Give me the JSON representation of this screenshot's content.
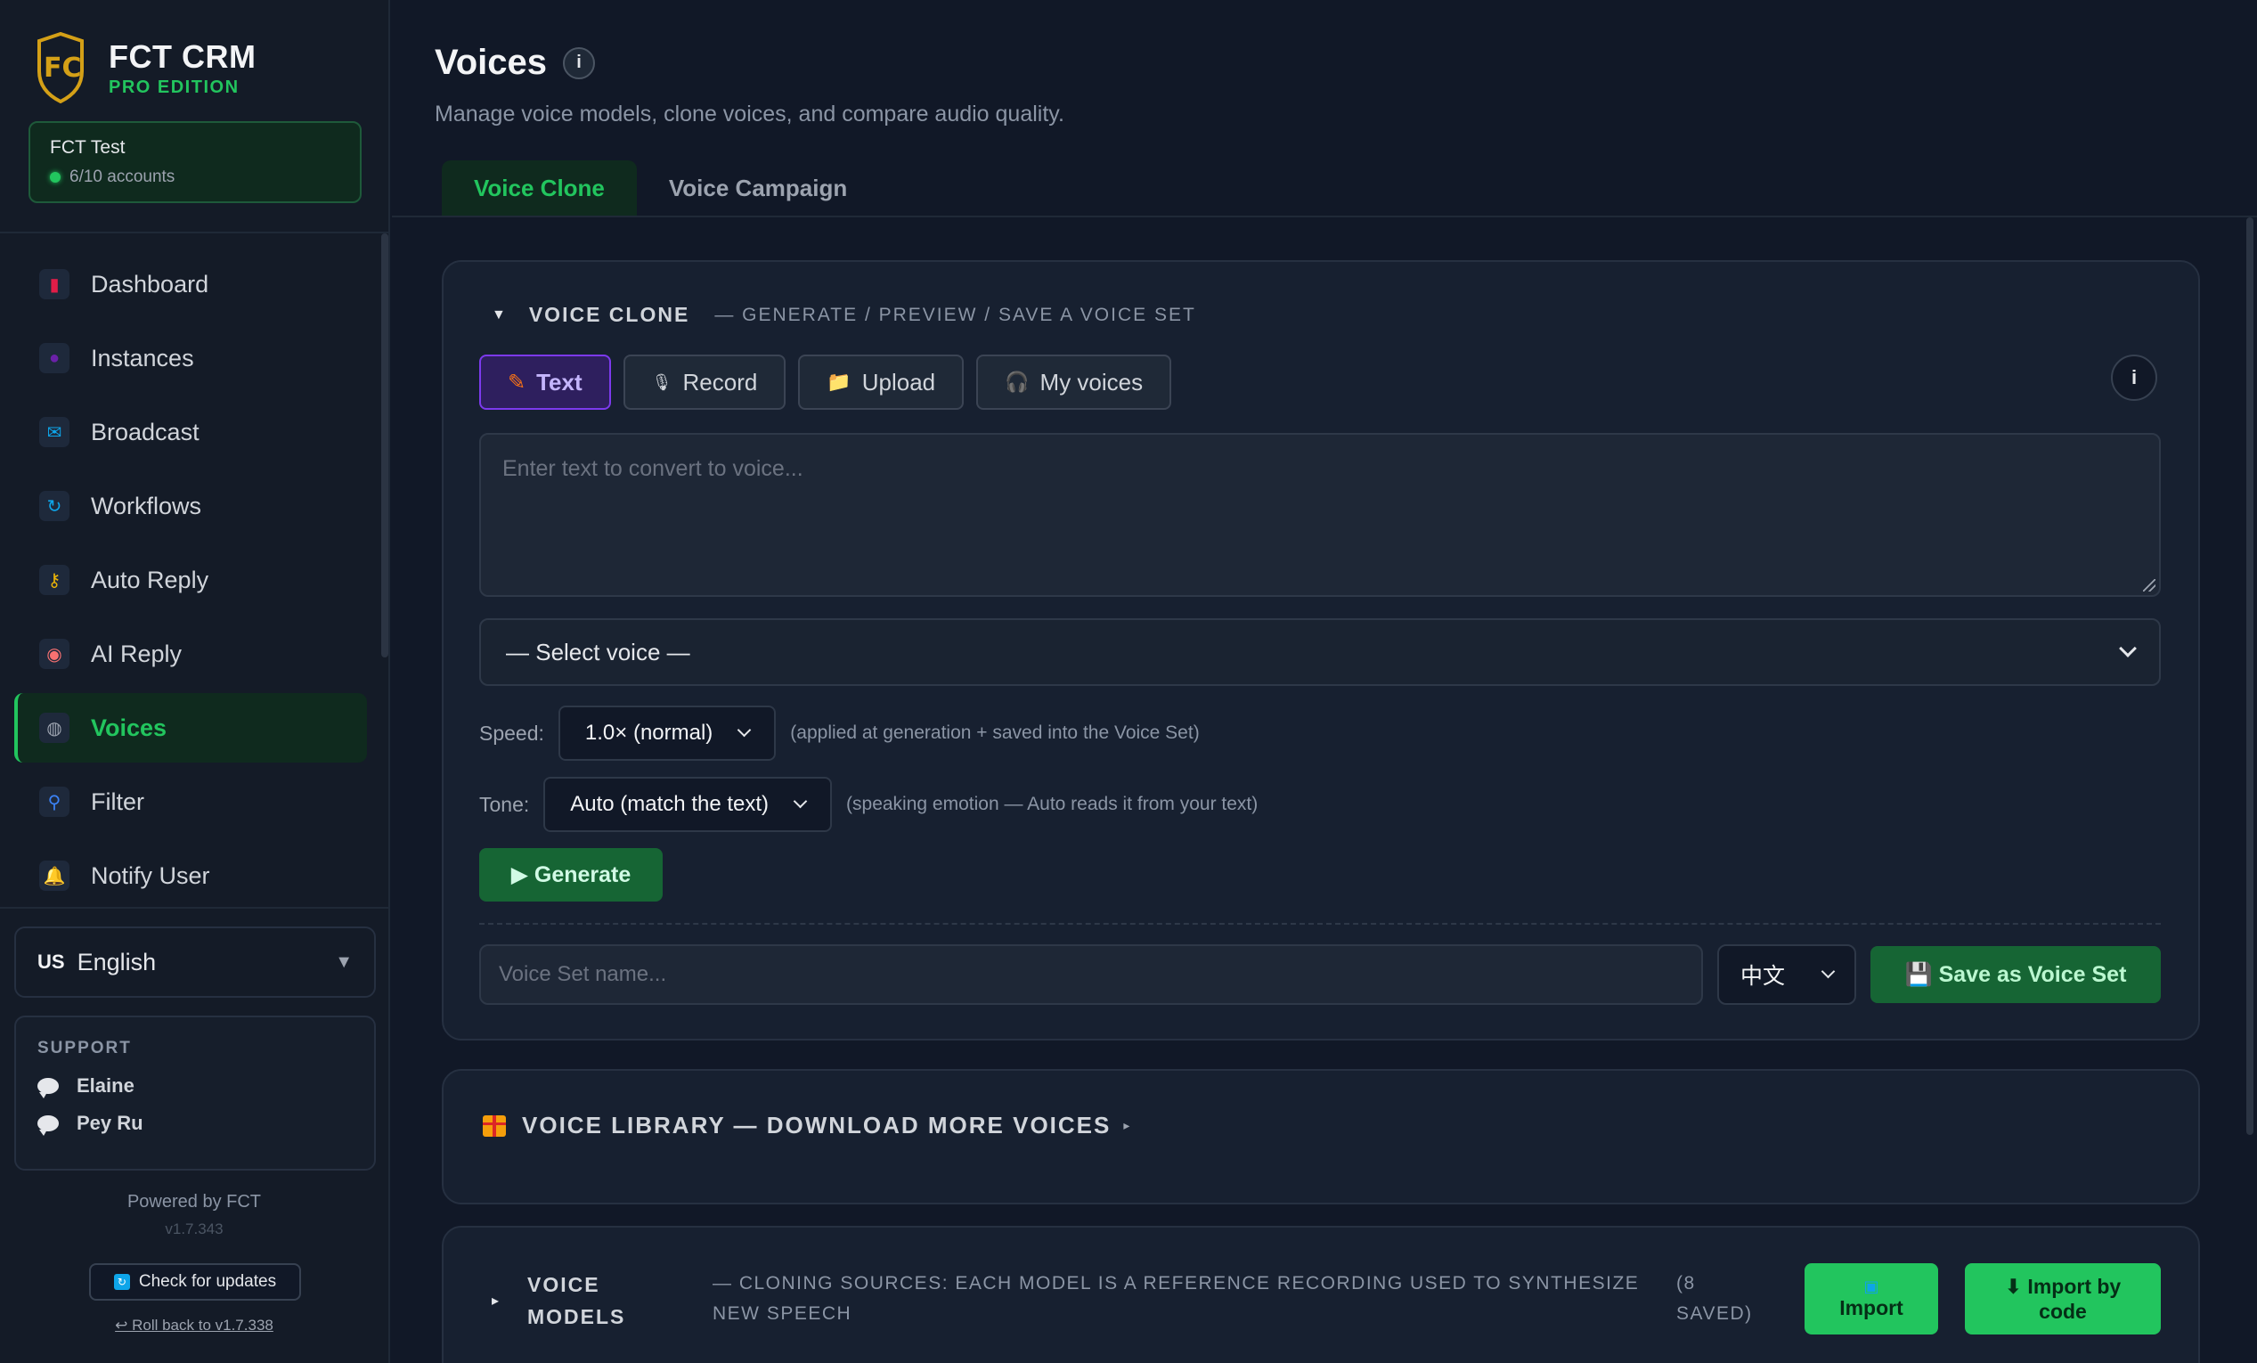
{
  "brand": {
    "title": "FCT CRM",
    "subtitle": "PRO EDITION"
  },
  "account": {
    "name": "FCT Test",
    "count": "6/10 accounts"
  },
  "nav": [
    {
      "label": "Dashboard",
      "icon": "bar-chart-icon",
      "color": "#e11d48",
      "glyph": "▮"
    },
    {
      "label": "Instances",
      "icon": "user-icon",
      "color": "#6b21a8",
      "glyph": "●"
    },
    {
      "label": "Broadcast",
      "icon": "mailbox-icon",
      "color": "#0ea5e9",
      "glyph": "✉"
    },
    {
      "label": "Workflows",
      "icon": "refresh-icon",
      "color": "#0ea5e9",
      "glyph": "↻"
    },
    {
      "label": "Auto Reply",
      "icon": "key-icon",
      "color": "#eab308",
      "glyph": "⚷"
    },
    {
      "label": "AI Reply",
      "icon": "robot-icon",
      "color": "#f87171",
      "glyph": "◉"
    },
    {
      "label": "Voices",
      "icon": "microphone-icon",
      "color": "#9ca3af",
      "glyph": "◍",
      "active": true
    },
    {
      "label": "Filter",
      "icon": "magnifier-icon",
      "color": "#3b82f6",
      "glyph": "⚲"
    },
    {
      "label": "Notify User",
      "icon": "bell-icon",
      "color": "#f59e0b",
      "glyph": "🔔"
    }
  ],
  "language": {
    "flag": "US",
    "value": "English"
  },
  "support": {
    "title": "SUPPORT",
    "people": [
      "Elaine",
      "Pey Ru"
    ]
  },
  "footer": {
    "powered": "Powered by FCT",
    "version": "v1.7.343",
    "update_label": "Check for updates",
    "rollback": "↩ Roll back to v1.7.338"
  },
  "page": {
    "title": "Voices",
    "subtitle": "Manage voice models, clone voices, and compare audio quality."
  },
  "tabs": [
    {
      "label": "Voice Clone",
      "active": true
    },
    {
      "label": "Voice Campaign",
      "active": false
    }
  ],
  "voice_clone": {
    "title": "VOICE CLONE",
    "description": "— GENERATE / PREVIEW / SAVE A VOICE SET",
    "modes": [
      {
        "label": "Text",
        "icon": "pencil-icon",
        "glyph": "✎",
        "active": true
      },
      {
        "label": "Record",
        "icon": "microphone-icon",
        "glyph": "🎙",
        "active": false
      },
      {
        "label": "Upload",
        "icon": "folder-icon",
        "glyph": "📁",
        "active": false
      },
      {
        "label": "My voices",
        "icon": "headphones-icon",
        "glyph": "🎧",
        "active": false
      }
    ],
    "text_placeholder": "Enter text to convert to voice...",
    "voice_select": "— Select voice —",
    "speed_label": "Speed:",
    "speed_value": "1.0× (normal)",
    "speed_hint": "(applied at generation + saved into the Voice Set)",
    "tone_label": "Tone:",
    "tone_value": "Auto (match the text)",
    "tone_hint": "(speaking emotion — Auto reads it from your text)",
    "generate_label": "▶ Generate",
    "set_name_placeholder": "Voice Set name...",
    "set_language": "中文",
    "save_label": "💾 Save as Voice Set"
  },
  "library": {
    "title": "VOICE LIBRARY — DOWNLOAD MORE VOICES"
  },
  "voice_models": {
    "title": "VOICE MODELS",
    "description": "— CLONING SOURCES: EACH MODEL IS A REFERENCE RECORDING USED TO SYNTHESIZE NEW SPEECH",
    "count": "(8 SAVED)",
    "import_label": "Import",
    "import_code_label": "⬇ Import by code"
  }
}
